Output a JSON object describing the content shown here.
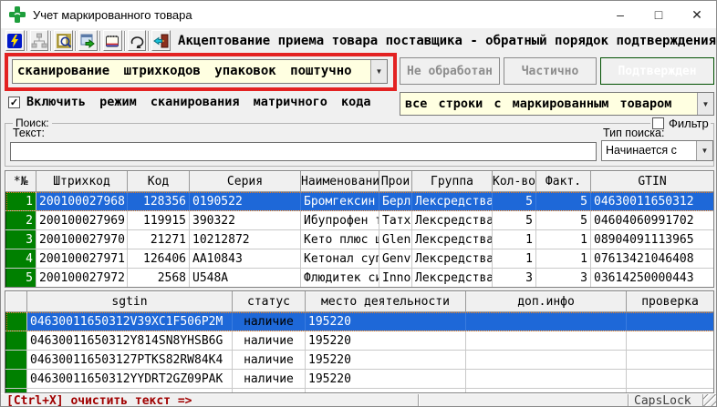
{
  "colors": {
    "accent_red_text": "#c00000",
    "highlight_border": "#e32222",
    "selection_blue": "#1e68d8",
    "indicator_green": "#008000",
    "confirmed_green": "#008000",
    "combo_bg": "#ffffe1"
  },
  "window": {
    "title": "Учет маркированного товара",
    "controls": {
      "minimize": "–",
      "maximize": "□",
      "close": "✕"
    }
  },
  "toolbar": {
    "icons": [
      "lightning-icon",
      "hierarchy-icon",
      "search-document-icon",
      "save-export-icon",
      "notebook-icon",
      "refresh-icon",
      "exit-door-icon"
    ],
    "caption": "Акцептование приема товара поставщика - обратный порядок подтверждения"
  },
  "scan_mode": {
    "value": "сканирование штрихкодов упаковок поштучно"
  },
  "status_buttons": {
    "unprocessed": "Не обработан",
    "partial": "Частично",
    "confirmed": "Подтвержден"
  },
  "matrix_checkbox": {
    "checked": true,
    "label": "Включить режим сканирования матричного кода",
    "mark": "✓"
  },
  "rows_filter": {
    "value": "все строки с маркированным товаром"
  },
  "search": {
    "group_label": "Поиск:",
    "filter_label": "Фильтр",
    "filter_checked": false,
    "text_label": "Текст:",
    "text_value": "",
    "type_label": "Тип поиска:",
    "type_value": "Начинается с"
  },
  "items_table": {
    "columns": [
      "*№",
      "Штрихкод",
      "Код",
      "Серия",
      "Наименовани",
      "Прои",
      "Группа",
      "Кол-во",
      "Факт.",
      "GTIN"
    ],
    "selected_index": 0,
    "rows": [
      [
        "1",
        "200100027968",
        "128356",
        "0190522",
        "Бромгексин",
        "Берли",
        "Лексредства",
        "5",
        "5",
        "04630011650312"
      ],
      [
        "2",
        "200100027969",
        "119915",
        "390322",
        "Ибупрофен т",
        "Татхи",
        "Лексредства",
        "5",
        "5",
        "04604060991702"
      ],
      [
        "3",
        "200100027970",
        "21271",
        "10212872",
        "Кето плюс ш",
        "Glenn",
        "Лексредства",
        "1",
        "1",
        "08904091113965"
      ],
      [
        "4",
        "200100027971",
        "126406",
        "AA10843",
        "Кетонал суп",
        "Genve",
        "Лексредства",
        "1",
        "1",
        "07613421046408"
      ],
      [
        "5",
        "200100027972",
        "2568",
        "U548A",
        "Флюдитек си",
        "Innot",
        "Лексредства",
        "3",
        "3",
        "03614250000443"
      ]
    ]
  },
  "sgtin_table": {
    "columns": [
      "",
      "sgtin",
      "статус",
      "место деятельности",
      "доп.инфо",
      "проверка"
    ],
    "selected_index": 0,
    "rows": [
      [
        "04630011650312V39XC1F506P2M",
        "наличие",
        "195220",
        "",
        ""
      ],
      [
        "04630011650312Y814SN8YHSB6G",
        "наличие",
        "195220",
        "",
        ""
      ],
      [
        "046300116503127PTKS82RW84K4",
        "наличие",
        "195220",
        "",
        ""
      ],
      [
        "04630011650312YYDRT2GZ09PAK",
        "наличие",
        "195220",
        "",
        ""
      ]
    ],
    "partial_row_visible": true
  },
  "statusbar": {
    "hint": "[Ctrl+X] очистить текст =>",
    "capslock": "CapsLock"
  }
}
